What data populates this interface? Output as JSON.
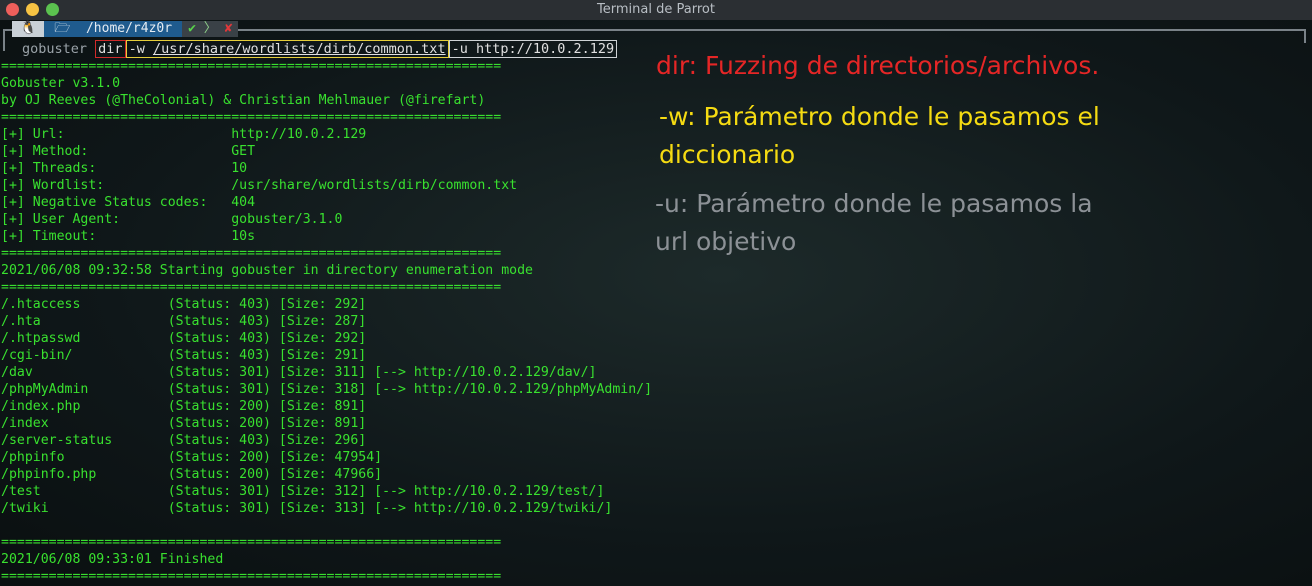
{
  "window": {
    "title": "Terminal de Parrot"
  },
  "prompt": {
    "os_glyph": "🐧",
    "folder_glyph": "🗁",
    "dir": "/home/r4z0r",
    "check": "✔",
    "arrow": "〉",
    "x": "✘"
  },
  "command": {
    "program": "gobuster",
    "mode": "dir",
    "wordlist_flag": "-w",
    "wordlist": "/usr/share/wordlists/dirb/common.txt",
    "url_flag": "-u",
    "url": "http://10.0.2.129"
  },
  "output": [
    "===============================================================",
    "Gobuster v3.1.0",
    "by OJ Reeves (@TheColonial) & Christian Mehlmauer (@firefart)",
    "===============================================================",
    "[+] Url:                     http://10.0.2.129",
    "[+] Method:                  GET",
    "[+] Threads:                 10",
    "[+] Wordlist:                /usr/share/wordlists/dirb/common.txt",
    "[+] Negative Status codes:   404",
    "[+] User Agent:              gobuster/3.1.0",
    "[+] Timeout:                 10s",
    "===============================================================",
    "2021/06/08 09:32:58 Starting gobuster in directory enumeration mode",
    "===============================================================",
    "/.htaccess           (Status: 403) [Size: 292]",
    "/.hta                (Status: 403) [Size: 287]",
    "/.htpasswd           (Status: 403) [Size: 292]",
    "/cgi-bin/            (Status: 403) [Size: 291]",
    "/dav                 (Status: 301) [Size: 311] [--> http://10.0.2.129/dav/]",
    "/phpMyAdmin          (Status: 301) [Size: 318] [--> http://10.0.2.129/phpMyAdmin/]",
    "/index.php           (Status: 200) [Size: 891]",
    "/index               (Status: 200) [Size: 891]",
    "/server-status       (Status: 403) [Size: 296]",
    "/phpinfo             (Status: 200) [Size: 47954]",
    "/phpinfo.php         (Status: 200) [Size: 47966]",
    "/test                (Status: 301) [Size: 312] [--> http://10.0.2.129/test/]",
    "/twiki               (Status: 301) [Size: 313] [--> http://10.0.2.129/twiki/]",
    "",
    "===============================================================",
    "2021/06/08 09:33:01 Finished",
    "==============================================================="
  ],
  "annotations": {
    "dir": "dir: Fuzzing de directorios/archivos.",
    "w_line1": "-w: Parámetro donde le pasamos el",
    "w_line2": "diccionario",
    "u_line1": "-u: Parámetro donde le pasamos la",
    "u_line2": "url objetivo"
  }
}
